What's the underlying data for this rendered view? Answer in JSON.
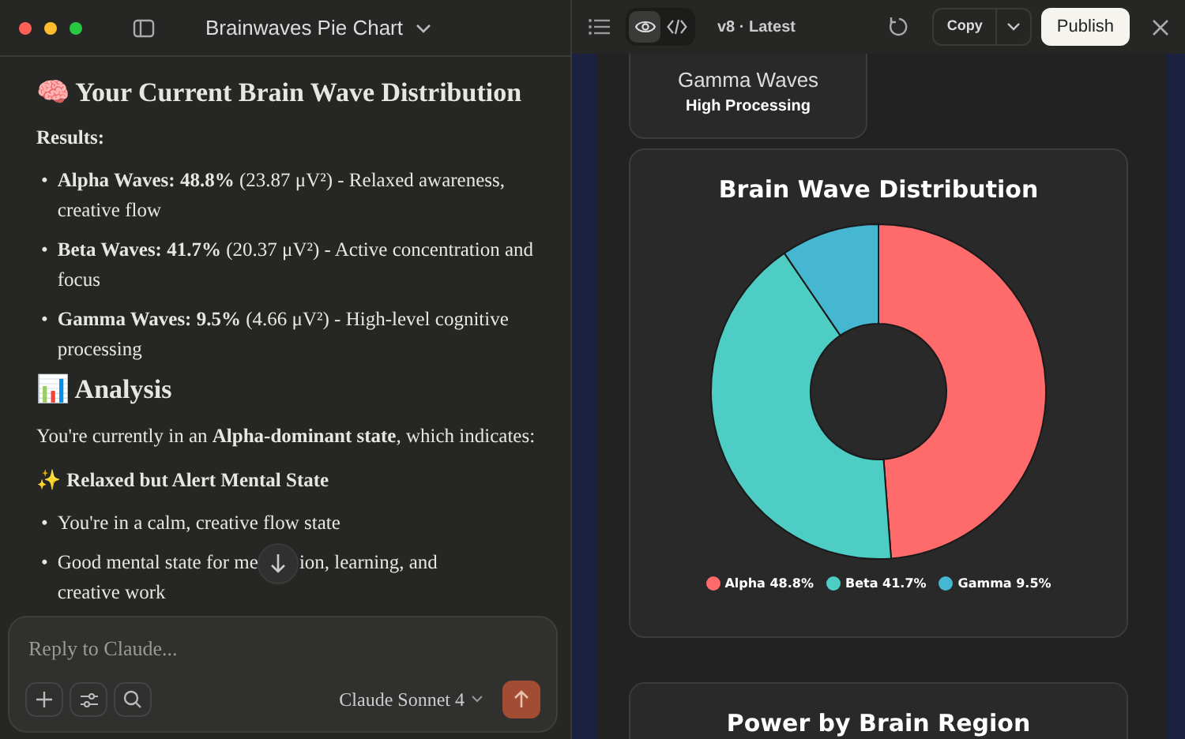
{
  "chat": {
    "title": "Brainwaves Pie Chart",
    "content": [
      {
        "kind": "heading",
        "text": "🧠 Your Current Brain Wave Distribution"
      },
      {
        "kind": "label",
        "text": "Results:"
      },
      {
        "kind": "list",
        "marker": "•",
        "items": [
          "**Alpha Waves: 48.8%** (23.87 μV²) - Relaxed awareness, creative flow",
          "**Beta Waves: 41.7%** (20.37 μV²) - Active concentration and focus",
          "**Gamma Waves: 9.5%** (4.66 μV²) - High-level cognitive processing"
        ]
      },
      {
        "kind": "heading",
        "text": "📊 Analysis"
      },
      {
        "kind": "paragraph",
        "text": "You're currently in an **Alpha-dominant state**, which indicates:"
      },
      {
        "kind": "label",
        "text": "✨ Relaxed but Alert Mental State"
      },
      {
        "kind": "list",
        "marker": "•",
        "items": [
          "You're in a calm, creative flow state",
          {
            "parts": [
              "Good mental state for me",
              "ion, learning, and",
              "creative work"
            ]
          }
        ]
      }
    ],
    "composer": {
      "placeholder": "Reply to Claude...",
      "model": "Claude Sonnet 4"
    }
  },
  "artifact": {
    "view_tabs": [
      {
        "kind": "preview",
        "selected": true
      },
      {
        "kind": "code",
        "selected": false
      }
    ],
    "version": "v8 · Latest",
    "copy": "Copy",
    "publish": "Publish",
    "gamma_card": {
      "title": "Gamma Waves",
      "subtitle": "High Processing"
    },
    "chart_card": {
      "chart_data": {
        "type": "donut",
        "title": "Brain Wave Distribution",
        "values": [
          48.8,
          41.7,
          9.5
        ]
      },
      "legend": [
        {
          "label": "Alpha 48.8%",
          "color": "#ff6b6b"
        },
        {
          "label": "Beta 41.7%",
          "color": "#4ecdc4"
        },
        {
          "label": "Gamma 9.5%",
          "color": "#45b7d1"
        }
      ]
    },
    "next_card_title": "Power by Brain Region"
  }
}
